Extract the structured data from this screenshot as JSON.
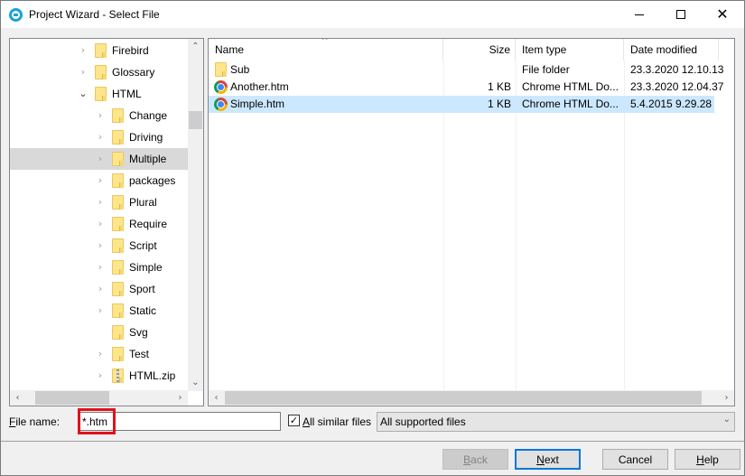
{
  "window": {
    "title": "Project Wizard - Select File",
    "controls": {
      "minimize": "minimize",
      "maximize": "maximize",
      "close": "close"
    }
  },
  "tree": {
    "items": [
      {
        "label": "Firebird",
        "expand": "collapsed",
        "icon": "folder-icon",
        "level": 1
      },
      {
        "label": "Glossary",
        "expand": "collapsed",
        "icon": "folder-icon",
        "level": 1
      },
      {
        "label": "HTML",
        "expand": "expanded",
        "icon": "folder-icon",
        "level": 1
      },
      {
        "label": "Change",
        "expand": "collapsed",
        "icon": "folder-icon",
        "level": 2
      },
      {
        "label": "Driving",
        "expand": "collapsed",
        "icon": "folder-icon",
        "level": 2
      },
      {
        "label": "Multiple",
        "expand": "collapsed",
        "icon": "folder-icon",
        "level": 2,
        "selected": true
      },
      {
        "label": "packages",
        "expand": "collapsed",
        "icon": "folder-icon",
        "level": 2
      },
      {
        "label": "Plural",
        "expand": "collapsed",
        "icon": "folder-icon",
        "level": 2
      },
      {
        "label": "Require",
        "expand": "collapsed",
        "icon": "folder-icon",
        "level": 2
      },
      {
        "label": "Script",
        "expand": "collapsed",
        "icon": "folder-icon",
        "level": 2
      },
      {
        "label": "Simple",
        "expand": "collapsed",
        "icon": "folder-icon",
        "level": 2
      },
      {
        "label": "Sport",
        "expand": "collapsed",
        "icon": "folder-icon",
        "level": 2
      },
      {
        "label": "Static",
        "expand": "collapsed",
        "icon": "folder-icon",
        "level": 2
      },
      {
        "label": "Svg",
        "expand": "none",
        "icon": "folder-icon",
        "level": 2
      },
      {
        "label": "Test",
        "expand": "collapsed",
        "icon": "folder-icon",
        "level": 2
      },
      {
        "label": "HTML.zip",
        "expand": "collapsed",
        "icon": "zip-folder-icon",
        "level": 2
      }
    ]
  },
  "file_list": {
    "columns": [
      {
        "key": "name",
        "label": "Name",
        "sorted": "ascending"
      },
      {
        "key": "size",
        "label": "Size"
      },
      {
        "key": "type",
        "label": "Item type"
      },
      {
        "key": "date",
        "label": "Date modified"
      }
    ],
    "rows": [
      {
        "name": "Sub",
        "size": "",
        "type": "File folder",
        "date": "23.3.2020 12.10.13",
        "icon": "folder-icon"
      },
      {
        "name": "Another.htm",
        "size": "1 KB",
        "type": "Chrome HTML Do...",
        "date": "23.3.2020 12.04.37",
        "icon": "chrome-icon"
      },
      {
        "name": "Simple.htm",
        "size": "1 KB",
        "type": "Chrome HTML Do...",
        "date": "5.4.2015 9.29.28",
        "icon": "chrome-icon",
        "selected": true
      }
    ]
  },
  "bottom": {
    "file_name_label_access": "F",
    "file_name_label_rest": "ile name:",
    "file_name_value": "*.htm",
    "all_similar_checked": true,
    "all_similar_access": "A",
    "all_similar_rest": "ll similar files",
    "filter_value": "All supported files"
  },
  "buttons": {
    "back_access": "B",
    "back_rest": "ack",
    "next_access": "N",
    "next_rest": "ext",
    "cancel": "Cancel",
    "help_access": "H",
    "help_rest": "elp"
  },
  "colors": {
    "selection": "#cce8ff",
    "tree_selection": "#d9d9d9",
    "default_button_border": "#0078d7",
    "highlight_box": "#e0121c"
  }
}
